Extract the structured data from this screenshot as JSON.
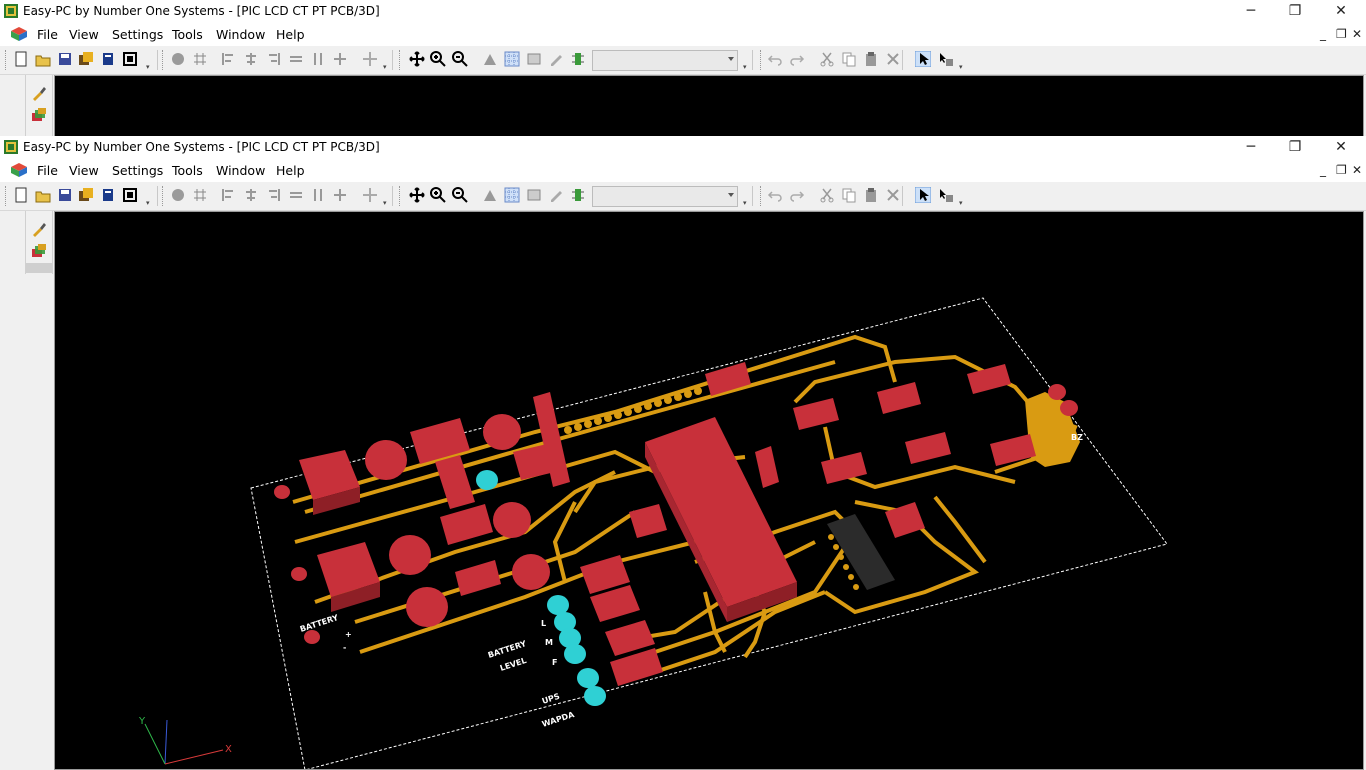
{
  "window": {
    "title": "Easy-PC by Number One Systems - [PIC LCD CT PT PCB/3D]",
    "controls": {
      "minimize": "─",
      "restore": "❐",
      "close": "✕"
    },
    "mdi_controls": {
      "minimize": "_",
      "restore": "❐",
      "close": "✕"
    }
  },
  "menu": {
    "file": "File",
    "view": "View",
    "settings": "Settings",
    "tools": "Tools",
    "window": "Window",
    "help": "Help"
  },
  "toolbar": {
    "layer_combo_value": ""
  },
  "pcb": {
    "labels": {
      "battery": "BATTERY",
      "battery_level": "BATTERY",
      "level": "LEVEL",
      "ups": "UPS",
      "wapda": "WAPDA",
      "l": "L",
      "m": "M",
      "f": "F",
      "bz": "BZ",
      "plus": "+",
      "minus": "-"
    },
    "axes": {
      "x": "X",
      "y": "Y"
    }
  },
  "colors": {
    "board": "#000000",
    "trace": "#d99b12",
    "component": "#c8303a",
    "led": "#2fd0d4",
    "chip": "#2b2b2b",
    "silkscreen": "#ffffff"
  }
}
